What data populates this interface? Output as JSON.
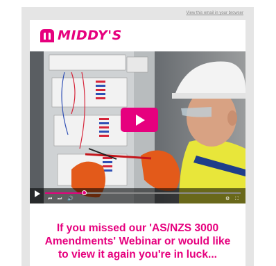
{
  "header": {
    "browser_link": "View this email in your browser"
  },
  "logo": {
    "text": "MIDDY'S",
    "brand_color": "#e6007e"
  },
  "video": {
    "play_icon": "play-icon",
    "progress_fraction": 0.2,
    "controls": {
      "play": "play-icon",
      "prev": "skip-back-icon",
      "next": "skip-forward-icon",
      "volume": "volume-icon",
      "settings": "gear-icon",
      "fullscreen": "fullscreen-icon"
    }
  },
  "main": {
    "headline": "If you missed our 'AS/NZS 3000 Amendments' Webinar or would like to view it again you're in luck..."
  }
}
